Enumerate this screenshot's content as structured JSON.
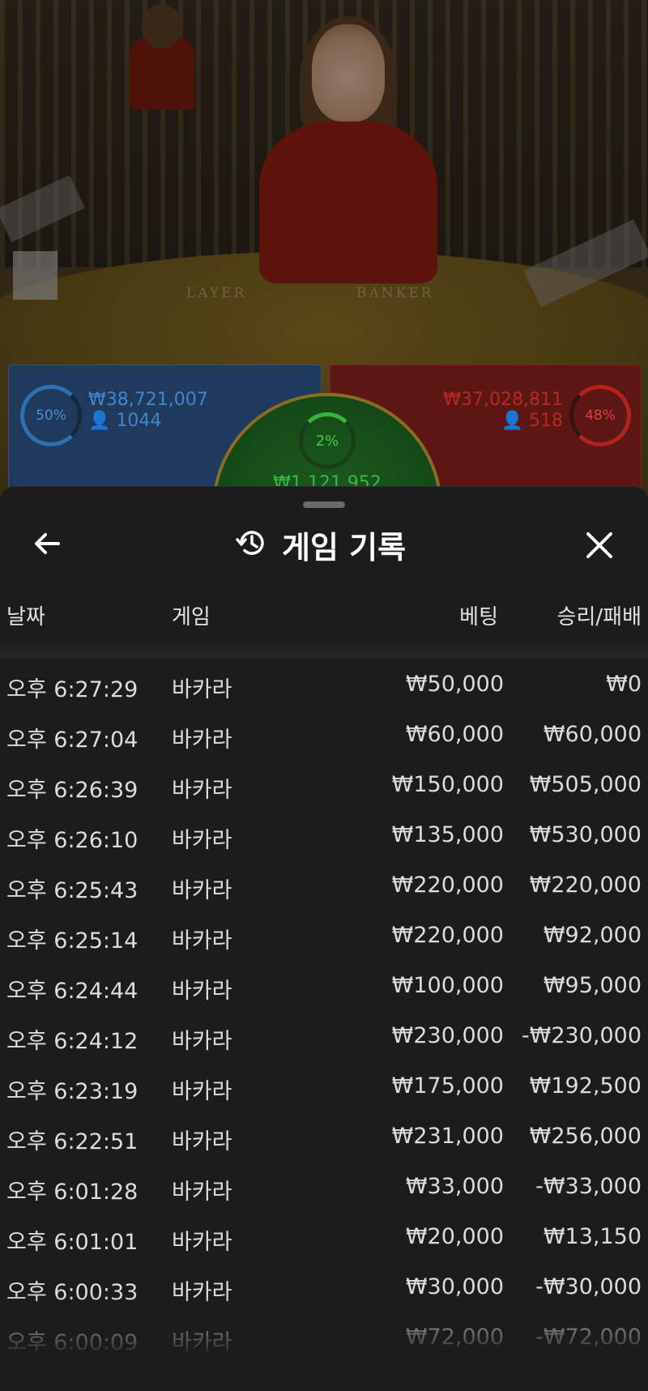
{
  "video": {
    "table_labels": [
      "LAYER",
      "BANKER"
    ]
  },
  "bets": {
    "player": {
      "percent": "50%",
      "amount": "₩38,721,007",
      "players": "1044"
    },
    "banker": {
      "percent": "48%",
      "amount": "₩37,028,811",
      "players": "518"
    },
    "tie": {
      "percent": "2%",
      "amount": "₩1,121,952"
    },
    "colors": {
      "player": "#1f3a5c",
      "banker": "#5c1714",
      "tie": "#1d5a1f"
    }
  },
  "sheet": {
    "title": "게임 기록",
    "icons": {
      "back": "arrow-left-icon",
      "history": "history-icon",
      "close": "close-icon"
    },
    "columns": {
      "date": "날짜",
      "game": "게임",
      "bet": "베팅",
      "result": "승리/패배"
    },
    "rows": [
      {
        "date": "오후 6:27:29",
        "game": "바카라",
        "bet": "₩50,000",
        "result": "₩0"
      },
      {
        "date": "오후 6:27:04",
        "game": "바카라",
        "bet": "₩60,000",
        "result": "₩60,000"
      },
      {
        "date": "오후 6:26:39",
        "game": "바카라",
        "bet": "₩150,000",
        "result": "₩505,000"
      },
      {
        "date": "오후 6:26:10",
        "game": "바카라",
        "bet": "₩135,000",
        "result": "₩530,000"
      },
      {
        "date": "오후 6:25:43",
        "game": "바카라",
        "bet": "₩220,000",
        "result": "₩220,000"
      },
      {
        "date": "오후 6:25:14",
        "game": "바카라",
        "bet": "₩220,000",
        "result": "₩92,000"
      },
      {
        "date": "오후 6:24:44",
        "game": "바카라",
        "bet": "₩100,000",
        "result": "₩95,000"
      },
      {
        "date": "오후 6:24:12",
        "game": "바카라",
        "bet": "₩230,000",
        "result": "-₩230,000"
      },
      {
        "date": "오후 6:23:19",
        "game": "바카라",
        "bet": "₩175,000",
        "result": "₩192,500"
      },
      {
        "date": "오후 6:22:51",
        "game": "바카라",
        "bet": "₩231,000",
        "result": "₩256,000"
      },
      {
        "date": "오후 6:01:28",
        "game": "바카라",
        "bet": "₩33,000",
        "result": "-₩33,000"
      },
      {
        "date": "오후 6:01:01",
        "game": "바카라",
        "bet": "₩20,000",
        "result": "₩13,150"
      },
      {
        "date": "오후 6:00:33",
        "game": "바카라",
        "bet": "₩30,000",
        "result": "-₩30,000"
      },
      {
        "date": "오후 6:00:09",
        "game": "바카라",
        "bet": "₩72,000",
        "result": "-₩72,000"
      }
    ]
  }
}
